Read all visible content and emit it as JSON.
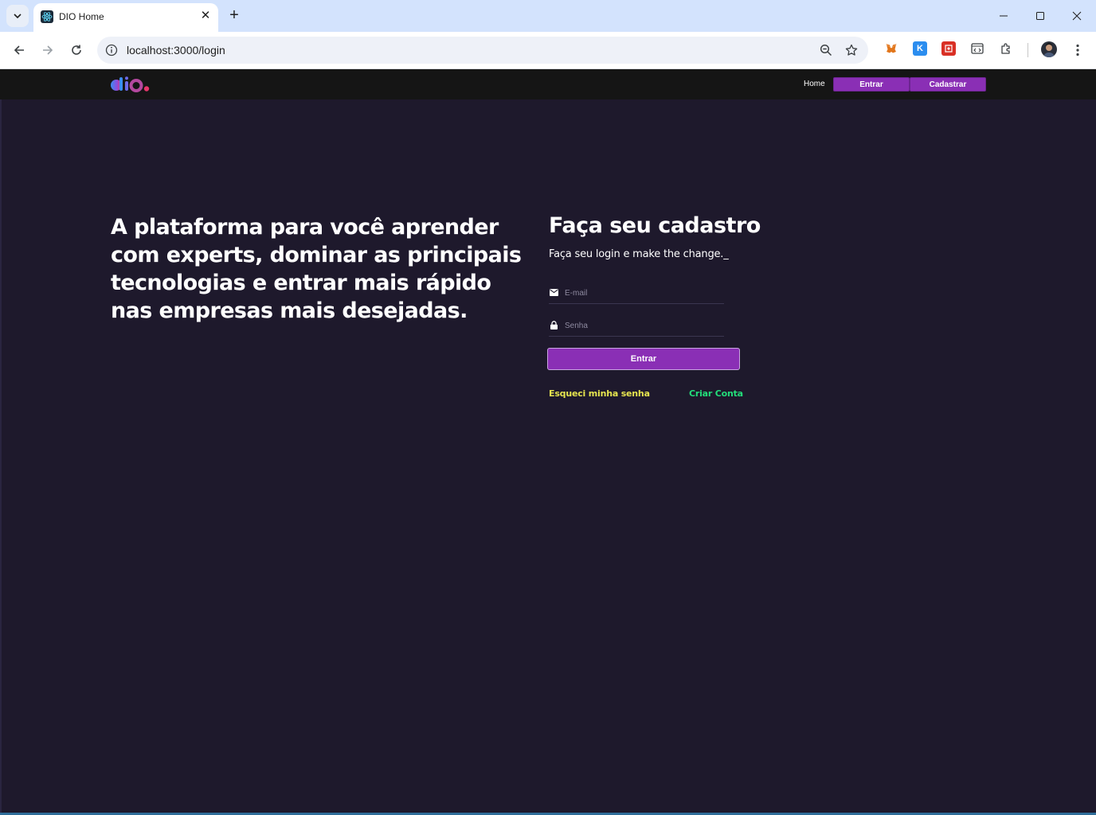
{
  "browser": {
    "tab_title": "DIO Home",
    "url": "localhost:3000/login",
    "icons": [
      "tab-search-icon",
      "react-favicon-icon",
      "close-icon",
      "plus-icon",
      "minimize-icon",
      "maximize-icon",
      "close-window-icon",
      "back-arrow-icon",
      "forward-arrow-icon",
      "reload-icon",
      "site-info-icon",
      "zoom-icon",
      "star-icon",
      "metamask-icon",
      "k-extension-icon",
      "red-extension-icon",
      "devtools-extension-icon",
      "puzzle-icon",
      "profile-avatar",
      "kebab-menu-icon"
    ]
  },
  "header": {
    "logo_text": "dio.",
    "nav_home": "Home",
    "nav_login": "Entrar",
    "nav_signup": "Cadastrar"
  },
  "hero": {
    "headline": "A plataforma para você aprender com experts, dominar as principais tecnologias e entrar mais rápido nas empresas mais desejadas."
  },
  "form": {
    "title": "Faça seu cadastro",
    "subtitle": "Faça seu login e make the change._",
    "email_placeholder": "E-mail",
    "password_placeholder": "Senha",
    "submit_label": "Entrar",
    "forgot_label": "Esqueci minha senha",
    "create_label": "Criar Conta"
  },
  "colors": {
    "background": "#1e192c",
    "header": "#151515",
    "accent": "#8a2fb5",
    "forgot": "#e5e44f",
    "create": "#23dd7a"
  }
}
